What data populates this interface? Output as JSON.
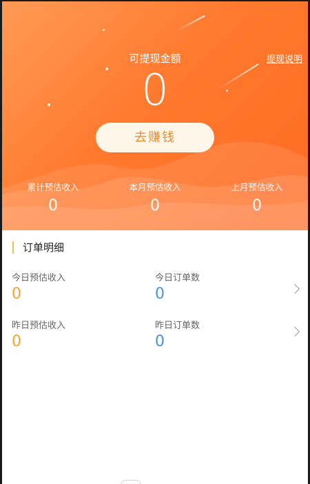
{
  "header": {
    "balance_label": "可提现金额",
    "balance_value": "0",
    "withdraw_info_link": "提现说明",
    "earn_button_label": "去赚钱"
  },
  "stats": [
    {
      "label": "累计预估收入",
      "value": "0"
    },
    {
      "label": "本月预估收入",
      "value": "0"
    },
    {
      "label": "上月预估收入",
      "value": "0"
    }
  ],
  "orders": {
    "title": "订单明细",
    "rows": [
      {
        "income_label": "今日预估收入",
        "income_value": "0",
        "count_label": "今日订单数",
        "count_value": "0"
      },
      {
        "income_label": "昨日预估收入",
        "income_value": "0",
        "count_label": "昨日订单数",
        "count_value": "0"
      }
    ]
  },
  "colors": {
    "header_gradient_start": "#ff9a55",
    "header_gradient_end": "#ff6a22",
    "button_text": "#f28b2c",
    "income_value": "#f2a33a",
    "count_value": "#4c93d8",
    "title_accent": "#f3c141"
  },
  "icons": {
    "row_chevron": "chevron-right-icon"
  }
}
